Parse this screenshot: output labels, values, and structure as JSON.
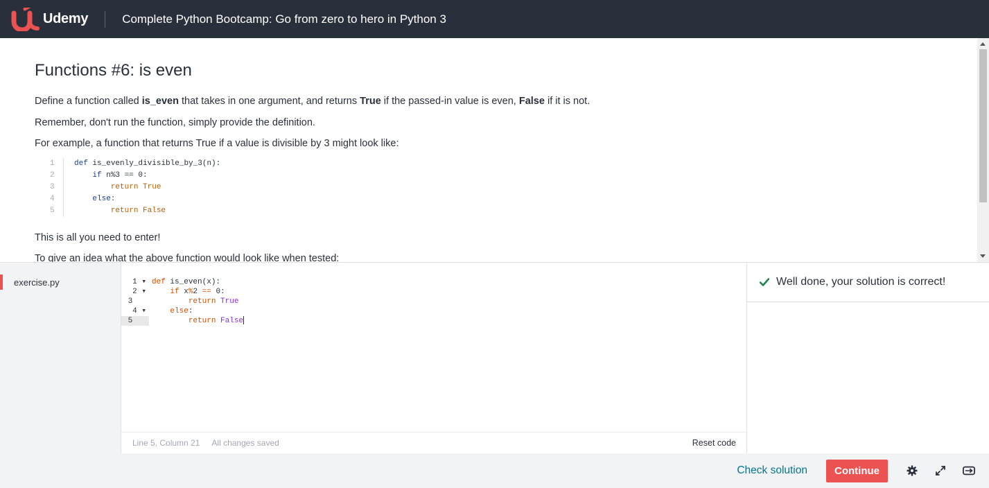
{
  "header": {
    "brand": "Udemy",
    "course_title": "Complete Python Bootcamp: Go from zero to hero in Python 3"
  },
  "instructions": {
    "title": "Functions #6: is even",
    "p1_before": "Define a function called ",
    "p1_bold1": "is_even",
    "p1_mid1": " that takes in one argument, and returns ",
    "p1_bold2": "True",
    "p1_mid2": " if the passed-in value is even, ",
    "p1_bold3": "False",
    "p1_after": " if it is not.",
    "p2": "Remember, don't run the function, simply provide the definition.",
    "p3": "For example, a function that returns True if a value is divisible by 3 might look like:",
    "sample_line_numbers": [
      "1",
      "2",
      "3",
      "4",
      "5"
    ],
    "p4": "This is all you need to enter!",
    "p5": "To give an idea what the above function would look like when tested:"
  },
  "files": {
    "active_file": "exercise.py"
  },
  "editor": {
    "line_numbers": [
      "1",
      "2",
      "3",
      "4",
      "5"
    ]
  },
  "status": {
    "position": "Line 5, Column 21",
    "saved": "All changes saved",
    "reset": "Reset code"
  },
  "result": {
    "message": "Well done, your solution is correct!"
  },
  "footer": {
    "check_solution": "Check solution",
    "continue": "Continue"
  },
  "icons": {
    "settings": "gear-icon",
    "expand": "expand-icon",
    "toggle_layout": "layout-toggle-icon"
  },
  "colors": {
    "header_bg": "#29303b",
    "brand_red": "#ec5252",
    "link_teal": "#007791",
    "success_green": "#1e8552"
  }
}
